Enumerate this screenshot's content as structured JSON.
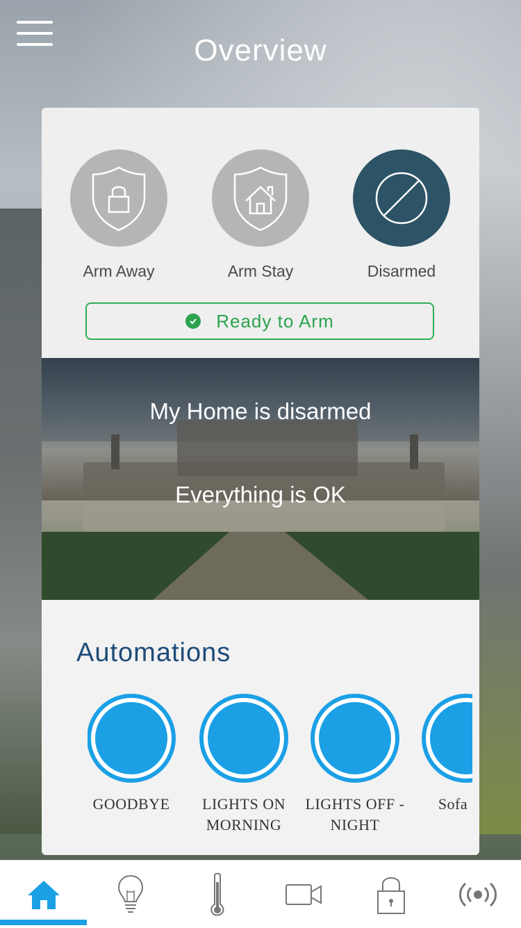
{
  "header": {
    "title": "Overview",
    "menu_icon": "hamburger-menu-icon"
  },
  "modes": [
    {
      "label": "Arm Away",
      "icon": "shield-lock-icon",
      "active": false
    },
    {
      "label": "Arm Stay",
      "icon": "shield-home-icon",
      "active": false
    },
    {
      "label": "Disarmed",
      "icon": "disarmed-slash-icon",
      "active": true
    }
  ],
  "status": {
    "label": "Ready to Arm",
    "icon": "check-circle-icon",
    "color": "#2ba34f"
  },
  "hero": {
    "line1": "My Home is disarmed",
    "line2": "Everything is OK"
  },
  "automations": {
    "title": "Automations",
    "items": [
      {
        "label": "GOODBYE"
      },
      {
        "label": "LIGHTS ON\nMORNING"
      },
      {
        "label": "LIGHTS OFF -\nNIGHT"
      },
      {
        "label": "Sofa Lar"
      }
    ]
  },
  "tabbar": {
    "active_index": 0,
    "tabs": [
      {
        "icon": "home-icon"
      },
      {
        "icon": "lightbulb-icon"
      },
      {
        "icon": "thermometer-icon"
      },
      {
        "icon": "video-camera-icon"
      },
      {
        "icon": "padlock-icon"
      },
      {
        "icon": "wireless-signal-icon"
      }
    ]
  },
  "colors": {
    "accent": "#1ba0e6",
    "disarmed": "#2c5366",
    "title_blue": "#1e4b78"
  }
}
